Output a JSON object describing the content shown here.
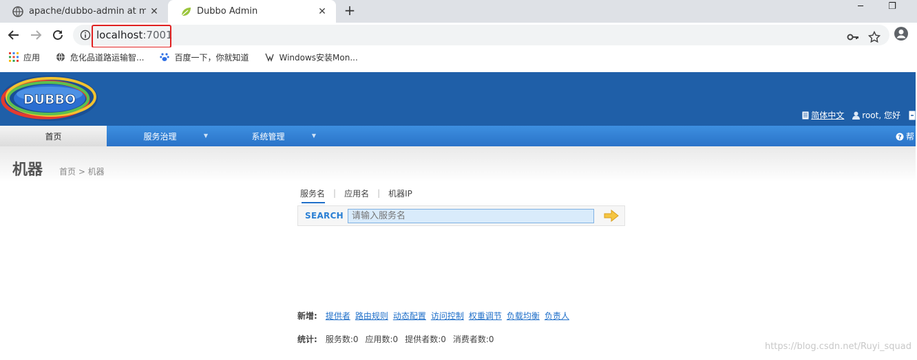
{
  "browser": {
    "tabs": [
      {
        "title": "apache/dubbo-admin at mast",
        "icon": "github-icon",
        "active": false
      },
      {
        "title": "Dubbo Admin",
        "icon": "spring-leaf-icon",
        "active": true
      }
    ],
    "new_tab": "+",
    "window_controls": {
      "minimize": "─",
      "restore": "❐"
    },
    "address": {
      "host": "localhost",
      "port": ":7001"
    },
    "bookmarks": [
      {
        "label": "应用",
        "icon": "apps-grid-icon"
      },
      {
        "label": "危化品道路运输智...",
        "icon": "globe-icon"
      },
      {
        "label": "百度一下，你就知道",
        "icon": "baidu-paw-icon"
      },
      {
        "label": "Windows安装Mon...",
        "icon": "mongodb-icon"
      }
    ]
  },
  "header": {
    "logo_text": "DUBBO",
    "lang_link": "简体中文",
    "user_text": "root, 您好",
    "help_text": "帮"
  },
  "menu": {
    "items": [
      {
        "label": "首页",
        "has_caret": false
      },
      {
        "label": "服务治理",
        "has_caret": true
      },
      {
        "label": "系统管理",
        "has_caret": true
      }
    ],
    "caret": "▼"
  },
  "page": {
    "title": "机器",
    "breadcrumb": "首页 > 机器"
  },
  "search": {
    "tabs": [
      "服务名",
      "应用名",
      "机器IP"
    ],
    "separator": "|",
    "label": "SEARCH",
    "placeholder": "请输入服务名"
  },
  "add": {
    "label": "新增:",
    "links": [
      "提供者",
      "路由规则",
      "动态配置",
      "访问控制",
      "权重调节",
      "负载均衡",
      "负责人"
    ]
  },
  "stats": {
    "label": "统计:",
    "items": [
      "服务数:0",
      "应用数:0",
      "提供者数:0",
      "消费者数:0"
    ]
  },
  "watermark": "https://blog.csdn.net/Ruyi_squad",
  "colors": {
    "header_blue": "#1f5fa8",
    "menu_blue": "#2a73c8",
    "link_blue": "#1f6fc9",
    "highlight_red": "#e02020"
  }
}
